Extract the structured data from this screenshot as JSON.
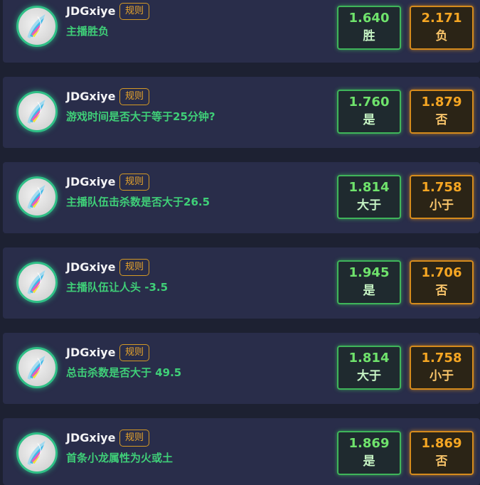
{
  "markets": [
    {
      "streamer": "JDGxiye",
      "rule_label": "规则",
      "question": "主播胜负",
      "option_a": {
        "odds": "1.640",
        "label": "胜"
      },
      "option_b": {
        "odds": "2.171",
        "label": "负"
      }
    },
    {
      "streamer": "JDGxiye",
      "rule_label": "规则",
      "question": "游戏时间是否大于等于25分钟?",
      "option_a": {
        "odds": "1.760",
        "label": "是"
      },
      "option_b": {
        "odds": "1.879",
        "label": "否"
      }
    },
    {
      "streamer": "JDGxiye",
      "rule_label": "规则",
      "question": "主播队伍击杀数是否大于26.5",
      "option_a": {
        "odds": "1.814",
        "label": "大于"
      },
      "option_b": {
        "odds": "1.758",
        "label": "小于"
      }
    },
    {
      "streamer": "JDGxiye",
      "rule_label": "规则",
      "question": "主播队伍让人头 -3.5",
      "option_a": {
        "odds": "1.945",
        "label": "是"
      },
      "option_b": {
        "odds": "1.706",
        "label": "否"
      }
    },
    {
      "streamer": "JDGxiye",
      "rule_label": "规则",
      "question": "总击杀数是否大于 49.5",
      "option_a": {
        "odds": "1.814",
        "label": "大于"
      },
      "option_b": {
        "odds": "1.758",
        "label": "小于"
      }
    },
    {
      "streamer": "JDGxiye",
      "rule_label": "规则",
      "question": "首条小龙属性为火或土",
      "option_a": {
        "odds": "1.869",
        "label": "是"
      },
      "option_b": {
        "odds": "1.869",
        "label": "否"
      }
    }
  ],
  "colors": {
    "page_bg": "#1d2132",
    "card_bg": "#292d4a",
    "question_green": "#3fcf78",
    "option_a_green": "#3fb55a",
    "option_b_orange": "#d68b1c",
    "rule_orange": "#d59a25"
  },
  "icons": {
    "avatar": "feather-avatar-icon"
  }
}
